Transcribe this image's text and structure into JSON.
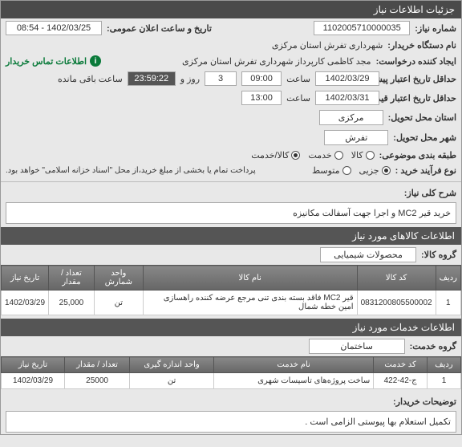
{
  "titleBar": "جزئیات اطلاعات نیاز",
  "fields": {
    "needNumber": {
      "label": "شماره نیاز:",
      "value": "1102005710000035"
    },
    "announceDateTime": {
      "label": "تاریخ و ساعت اعلان عمومی:",
      "value": "1402/03/25 - 08:54"
    },
    "buyerOrg": {
      "label": "نام دستگاه خریدار:",
      "value": "شهرداری تفرش استان مرکزی"
    },
    "requester": {
      "label": "ایجاد کننده درخواست:",
      "value": "مجد کاظمی کارپرداز شهرداری تفرش استان مرکزی"
    },
    "contactInfo": {
      "icon": "i",
      "text": "اطلاعات تماس خریدار"
    },
    "deadline": {
      "label": "حداقل تاریخ اعتبار پیشنهاد:",
      "date": "1402/03/29",
      "timeLabel": "ساعت",
      "time": "09:00",
      "daysValue": "3",
      "daysLabel": "روز و",
      "remainValue": "23:59:22",
      "remainLabel": "ساعت باقی مانده"
    },
    "validity": {
      "label": "حداقل تاریخ اعتبار قیمت: تا تاریخ:",
      "date": "1402/03/31",
      "timeLabel": "ساعت",
      "time": "13:00"
    },
    "province": {
      "label": "استان محل تحویل:",
      "value": "مرکزی"
    },
    "city": {
      "label": "شهر محل تحویل:",
      "value": "تفرش"
    },
    "classification": {
      "label": "طبقه بندی موضوعی:",
      "options": [
        {
          "text": "کالا",
          "checked": false
        },
        {
          "text": "خدمت",
          "checked": false
        },
        {
          "text": "کالا/خدمت",
          "checked": true
        }
      ]
    },
    "buyProcess": {
      "label": "نوع فرآیند خرید :",
      "options": [
        {
          "text": "جزیی",
          "checked": true
        },
        {
          "text": "متوسط",
          "checked": false
        }
      ],
      "note": "پرداخت تمام یا بخشی از مبلغ خرید،از محل \"اسناد خزانه اسلامی\" خواهد بود."
    }
  },
  "generalDesc": {
    "label": "شرح کلی نیاز:",
    "value": "خرید قیر MC2 و اجرا جهت آسفالت مکانیزه"
  },
  "goodsSection": {
    "header": "اطلاعات کالاهای مورد نیاز",
    "groupLabel": "گروه کالا:",
    "groupValue": "محصولات شیمیایی",
    "columns": [
      "ردیف",
      "کد کالا",
      "نام کالا",
      "واحد شمارش",
      "تعداد / مقدار",
      "تاریخ نیاز"
    ],
    "rows": [
      {
        "idx": "1",
        "code": "0831200805500002",
        "name": "قیر MC2 فاقد بسته بندی تنی مرجع عرضه کننده راهسازی امین خطه شمال",
        "unit": "تن",
        "qty": "25,000",
        "date": "1402/03/29"
      }
    ]
  },
  "servicesSection": {
    "header": "اطلاعات خدمات مورد نیاز",
    "groupLabel": "گروه خدمت:",
    "groupValue": "ساختمان",
    "columns": [
      "ردیف",
      "کد خدمت",
      "نام خدمت",
      "واحد اندازه گیری",
      "تعداد / مقدار",
      "تاریخ نیاز"
    ],
    "rows": [
      {
        "idx": "1",
        "code": "ج-42-422",
        "name": "ساخت پروژه‌های تاسیسات شهری",
        "unit": "تن",
        "qty": "25000",
        "date": "1402/03/29"
      }
    ]
  },
  "buyerNotes": {
    "label": "توضیحات خریدار:",
    "value": "تکمیل استعلام بها پیوستی الزامی است ."
  }
}
